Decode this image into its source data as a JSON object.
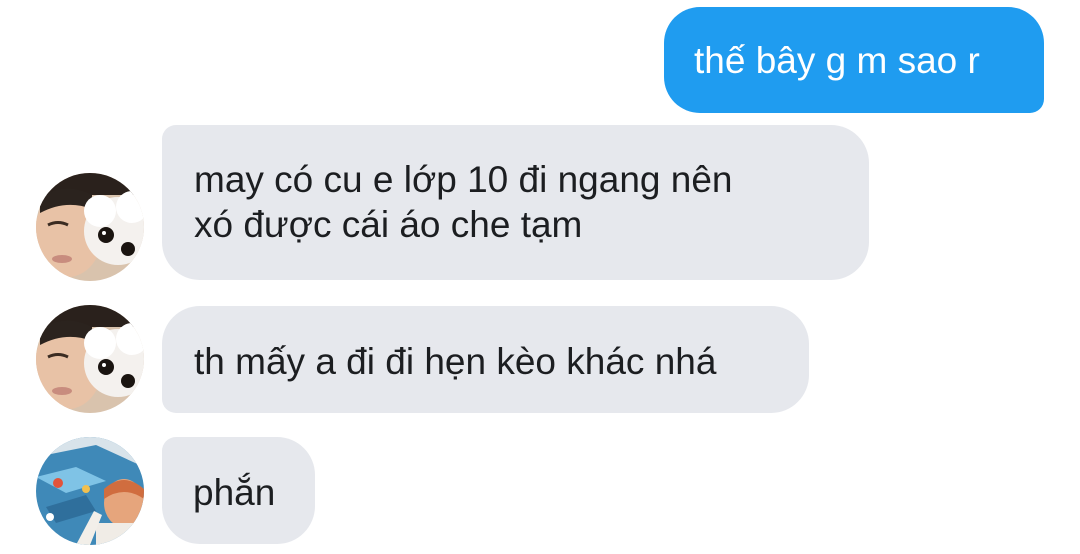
{
  "conversation": {
    "messages": [
      {
        "id": "m1",
        "direction": "outgoing",
        "lines": [
          "thế bây g m sao r"
        ]
      },
      {
        "id": "m2",
        "direction": "incoming",
        "sender_avatar": "face-with-dog-avatar",
        "lines": [
          "may có cu e lớp 10 đi ngang nên",
          "xó được cái áo che tạm"
        ]
      },
      {
        "id": "m3",
        "direction": "incoming",
        "sender_avatar": "face-with-dog-avatar",
        "lines": [
          "th mấy a đi đi hẹn kèo khác nhá"
        ]
      },
      {
        "id": "m4",
        "direction": "incoming",
        "sender_avatar": "person-by-pool-avatar",
        "lines": [
          "phắn"
        ]
      }
    ]
  },
  "colors": {
    "outgoing_bubble": "#1f9cf0",
    "incoming_bubble": "#e6e8ed",
    "incoming_text": "#1c1e21",
    "outgoing_text": "#ffffff"
  }
}
